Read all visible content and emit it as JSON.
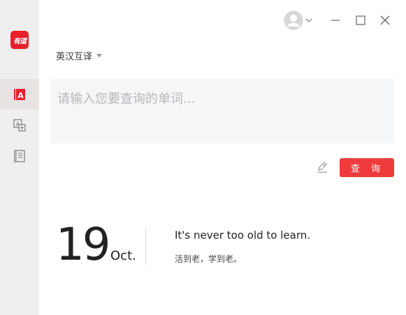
{
  "sidebar": {
    "logo_text": "有道",
    "items": [
      {
        "name": "dictionary",
        "active": true
      },
      {
        "name": "translate",
        "active": false
      },
      {
        "name": "wordbook",
        "active": false
      }
    ]
  },
  "topbar": {
    "avatar": "avatar-icon",
    "controls": [
      "minimize-icon",
      "maximize-icon",
      "close-icon"
    ]
  },
  "language": {
    "selected": "英汉互译"
  },
  "query": {
    "placeholder": "请输入您要查询的单词...",
    "value": ""
  },
  "search_button": {
    "label": "查 询"
  },
  "daily": {
    "day": "19",
    "month": "Oct.",
    "sentence_en": "It's never too old to learn.",
    "sentence_zh": "活到老，学到老。"
  },
  "colors": {
    "accent": "#ef3b3b",
    "sidebar_bg": "#f0efef",
    "query_bg": "#f5f6f7"
  }
}
